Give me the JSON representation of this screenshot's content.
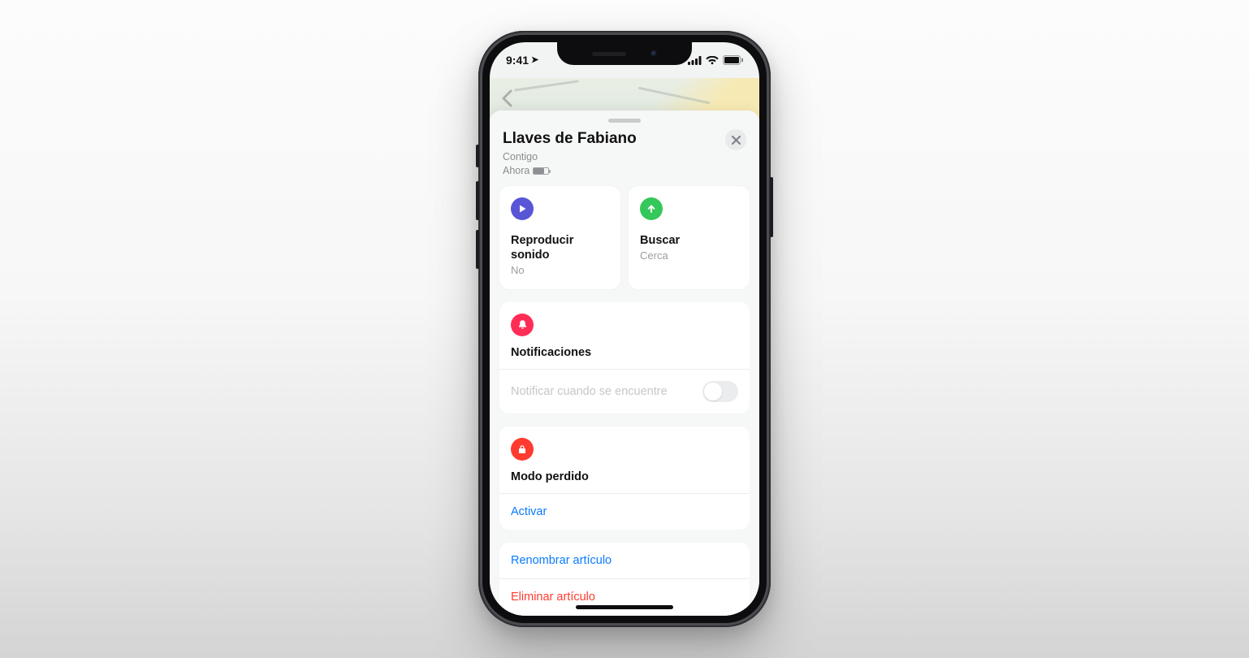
{
  "status": {
    "time": "9:41",
    "location_arrow": "➤"
  },
  "sheet": {
    "title": "Llaves de Fabiano",
    "sub1": "Contigo",
    "sub2": "Ahora"
  },
  "actions": {
    "play": {
      "title": "Reproducir sonido",
      "sub": "No"
    },
    "find": {
      "title": "Buscar",
      "sub": "Cerca"
    }
  },
  "notifications": {
    "title": "Notificaciones",
    "toggle_label": "Notificar cuando se encuentre"
  },
  "lost_mode": {
    "title": "Modo perdido",
    "activate": "Activar"
  },
  "item_actions": {
    "rename": "Renombrar artículo",
    "remove": "Eliminar artículo"
  }
}
